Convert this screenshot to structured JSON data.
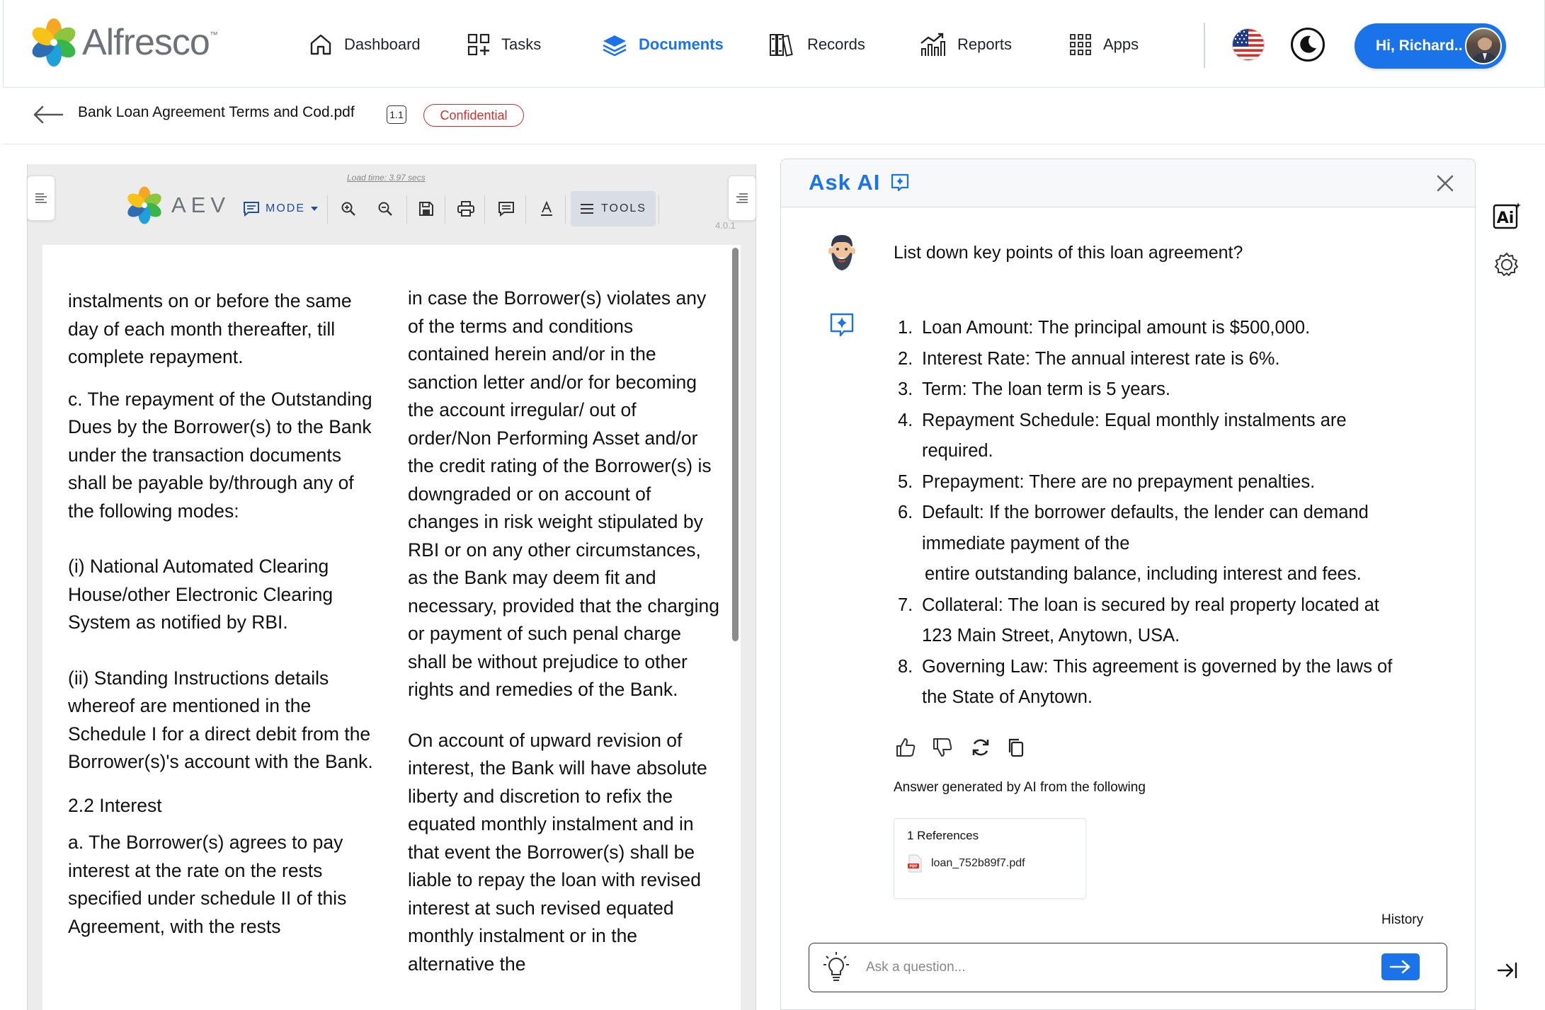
{
  "brand": {
    "name": "Alfresco",
    "tm": "™"
  },
  "nav": {
    "items": [
      {
        "key": "dashboard",
        "label": "Dashboard",
        "icon": "home-icon"
      },
      {
        "key": "tasks",
        "label": "Tasks",
        "icon": "tasks-icon"
      },
      {
        "key": "documents",
        "label": "Documents",
        "icon": "layers-icon",
        "active": true
      },
      {
        "key": "records",
        "label": "Records",
        "icon": "records-icon"
      },
      {
        "key": "reports",
        "label": "Reports",
        "icon": "chart-icon"
      },
      {
        "key": "apps",
        "label": "Apps",
        "icon": "grid-icon"
      }
    ],
    "user_greeting": "Hi, Richard..",
    "active_color": "#1a73e8"
  },
  "breadcrumb": {
    "file_name": "Bank Loan Agreement Terms and Cod.pdf",
    "version": "1.1",
    "classification": "Confidential"
  },
  "viewer": {
    "load_time": "Load time: 3.97 secs",
    "brand": "AEV",
    "mode_label": "MODE",
    "tools_label": "TOOLS",
    "version": "4.0.1",
    "col1": [
      "instalments on or before the same day of each month thereafter, till complete repayment.",
      "c.  The repayment of the Outstanding Dues by the Borrower(s) to the Bank under the transaction documents shall be payable by/through any of the following modes:",
      "(i)  National Automated Clearing House/other Electronic Clearing System as notified by RBI.",
      "(ii)  Standing Instructions details whereof are mentioned in the Schedule I for a direct debit from the Borrower(s)'s account with the Bank.",
      "2.2 Interest",
      "a.  The Borrower(s) agrees to pay interest at the rate on the rests specified under schedule II of this Agreement, with the rests"
    ],
    "col2": [
      "in case the Borrower(s) violates any of the terms and conditions contained herein and/or in the sanction letter and/or for becoming the account irregular/ out of order/Non Performing Asset and/or the credit rating of the Borrower(s) is downgraded or on account of changes in risk weight stipulated by RBI or on any other circumstances, as the Bank may deem fit and necessary, provided that the charging or payment of such penal charge shall be without prejudice to other rights and remedies of the Bank.",
      "On account of upward revision of interest, the Bank will have absolute liberty and discretion to refix the equated monthly instalment and in that event the Borrower(s) shall be liable to repay the loan with revised interest at such revised equated monthly instalment or in the alternative the"
    ]
  },
  "ai": {
    "title": "Ask AI",
    "question": "List down key points of this loan agreement?",
    "answer": [
      {
        "n": "1.",
        "lines": [
          "Loan Amount: The principal amount is $500,000."
        ]
      },
      {
        "n": "2.",
        "lines": [
          "Interest Rate: The annual interest rate is 6%."
        ]
      },
      {
        "n": "3.",
        "lines": [
          "Term: The loan term is 5 years."
        ]
      },
      {
        "n": "4.",
        "lines": [
          "Repayment Schedule: Equal monthly instalments are",
          "required."
        ]
      },
      {
        "n": "5.",
        "lines": [
          "Prepayment: There are no prepayment penalties."
        ]
      },
      {
        "n": "6.",
        "lines": [
          "Default: If the borrower defaults, the lender can demand",
          "immediate payment of the",
          " entire outstanding balance, including interest and fees."
        ]
      },
      {
        "n": "7.",
        "lines": [
          "Collateral: The loan is secured by real property located at",
          "123 Main Street, Anytown, USA."
        ]
      },
      {
        "n": "8.",
        "lines": [
          "Governing Law: This agreement is governed by the laws of",
          "the State of Anytown."
        ]
      }
    ],
    "generated_note": "Answer generated by AI from the following",
    "references_title": "1 References",
    "reference_file": "loan_752b89f7.pdf",
    "history_label": "History",
    "input_placeholder": "Ask a question...",
    "input_value": ""
  },
  "rail": {
    "ai_label": "Ai"
  }
}
